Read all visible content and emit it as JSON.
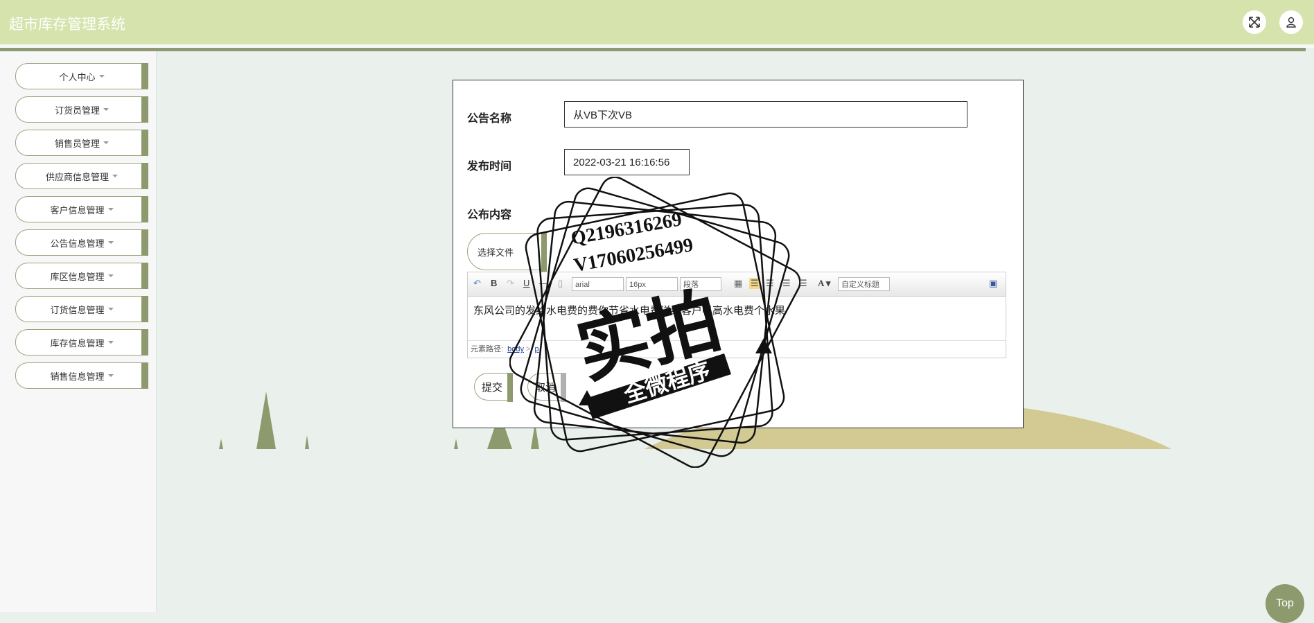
{
  "header": {
    "title": "超市库存管理系统",
    "icons": [
      "fullscreen-icon",
      "user-icon"
    ]
  },
  "sidebar": {
    "items": [
      {
        "label": "个人中心"
      },
      {
        "label": "订货员管理"
      },
      {
        "label": "销售员管理"
      },
      {
        "label": "供应商信息管理"
      },
      {
        "label": "客户信息管理"
      },
      {
        "label": "公告信息管理"
      },
      {
        "label": "库区信息管理"
      },
      {
        "label": "订货信息管理"
      },
      {
        "label": "库存信息管理"
      },
      {
        "label": "销售信息管理"
      }
    ]
  },
  "form": {
    "name_label": "公告名称",
    "name_value": "从VB下次VB",
    "time_label": "发布时间",
    "time_value": "2022-03-21 16:16:56",
    "content_label": "公布内容",
    "file_button": "选择文件",
    "editor": {
      "font_family": "arial",
      "font_size": "16px",
      "paragraph": "段落",
      "custom_heading": "自定义标题",
      "content": "东风公司的发给水电费的费你节省水电费送给客户帆高水电费个水果",
      "path_label": "元素路径:",
      "path_body": "body",
      "path_p": "p"
    },
    "submit_label": "提交",
    "cancel_label": "取消"
  },
  "watermark": {
    "line1": "Q2196316269",
    "line2": "V17060256499",
    "main": "实拍",
    "banner": "全微程序"
  },
  "top_button": "Top",
  "colors": {
    "header_bg": "#d6e3ac",
    "accent": "#8d9a6d",
    "page_bg": "#eaf1ec"
  }
}
